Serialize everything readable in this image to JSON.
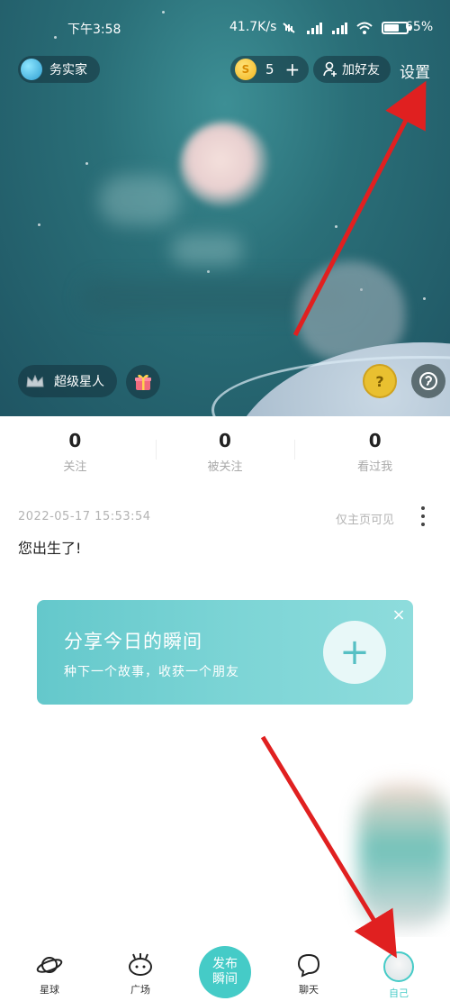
{
  "status_bar": {
    "time": "下午3:58",
    "network_speed": "41.7K/s",
    "battery": "65%"
  },
  "header": {
    "badge_label": "务实家",
    "coin_count": "5",
    "coin_plus": "+",
    "add_friend_label": "加好友",
    "settings_label": "设置"
  },
  "profile": {
    "vip_label": "超级星人",
    "cat_icon_glyph": "?"
  },
  "stats": [
    {
      "value": "0",
      "label": "关注"
    },
    {
      "value": "0",
      "label": "被关注"
    },
    {
      "value": "0",
      "label": "看过我"
    }
  ],
  "post": {
    "timestamp": "2022-05-17 15:53:54",
    "visibility": "仅主页可见",
    "text": "您出生了!"
  },
  "share_card": {
    "title": "分享今日的瞬间",
    "subtitle": "种下一个故事，收获一个朋友",
    "plus": "+",
    "close": "×"
  },
  "bottom_nav": {
    "items": [
      {
        "label": "星球",
        "icon": "planet-icon"
      },
      {
        "label": "广场",
        "icon": "square-icon"
      },
      {
        "label": "发布瞬间",
        "icon": "publish-button"
      },
      {
        "label": "聊天",
        "icon": "chat-icon"
      },
      {
        "label": "自己",
        "icon": "self-avatar-icon",
        "active": true
      }
    ],
    "publish_line1": "发布",
    "publish_line2": "瞬间"
  },
  "colors": {
    "accent": "#45cbc7",
    "annotation_arrow": "#e02020"
  }
}
